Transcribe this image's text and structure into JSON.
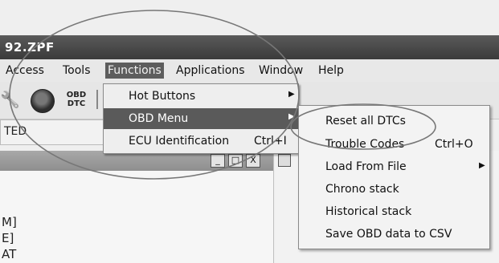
{
  "window": {
    "title": "92.ZPF"
  },
  "menubar": [
    {
      "label": "Access",
      "active": false
    },
    {
      "label": "Tools",
      "active": false
    },
    {
      "label": "Functions",
      "active": true
    },
    {
      "label": "Applications",
      "active": false
    },
    {
      "label": "Window",
      "active": false
    },
    {
      "label": "Help",
      "active": false
    }
  ],
  "toolbar": {
    "obd_dtc_label": "OBD DTC",
    "icons": [
      "wrench-icon",
      "gauge-icon",
      "obd-dtc-icon"
    ]
  },
  "status_label": "TED",
  "functions_menu": [
    {
      "label": "Hot Buttons",
      "shortcut": "",
      "submenu": true,
      "active": false
    },
    {
      "label": "OBD Menu",
      "shortcut": "",
      "submenu": true,
      "active": true
    },
    {
      "label": "ECU Identification",
      "shortcut": "Ctrl+I",
      "submenu": false,
      "active": false
    }
  ],
  "obd_submenu": [
    {
      "label": "Reset all DTCs",
      "shortcut": "",
      "submenu": false
    },
    {
      "label": "Trouble Codes",
      "shortcut": "Ctrl+O",
      "submenu": false
    },
    {
      "label": "Load From File",
      "shortcut": "",
      "submenu": true
    },
    {
      "label": "Chrono stack",
      "shortcut": "",
      "submenu": false
    },
    {
      "label": "Historical stack",
      "shortcut": "",
      "submenu": false
    },
    {
      "label": "Save OBD data to CSV",
      "shortcut": "",
      "submenu": false
    }
  ],
  "inner_window": {
    "controls": [
      "_",
      "□",
      "X"
    ],
    "lines": [
      "M]",
      "E]",
      "AT"
    ]
  }
}
